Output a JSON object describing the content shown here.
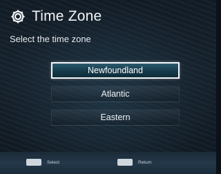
{
  "header": {
    "title": "Time Zone",
    "icon": "gear-icon"
  },
  "subtitle": "Select the time zone",
  "time_zones": {
    "selected": "Newfoundland",
    "options": [
      {
        "label": "Newfoundland"
      },
      {
        "label": "Atlantic"
      },
      {
        "label": "Eastern"
      }
    ]
  },
  "footer": {
    "select_label": "Select",
    "return_label": "Return"
  },
  "colors": {
    "selection_border": "#f5f7f9",
    "selection_fill": "#1d4556",
    "background": "#141f29"
  }
}
